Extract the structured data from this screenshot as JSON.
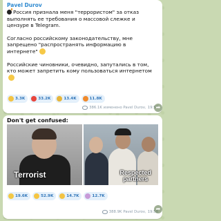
{
  "message1": {
    "sender": "Pavel Durov",
    "paragraphs": [
      "Россия признала меня \"террористом\" за отказ выполнять ее требования о массовой слежке и цензуре в Telegram.",
      "Согласно российскому законодательству, мне запрещено \"распространять информацию в интернете\"",
      "Российские чиновники, очевидно, запутались в том, кто может запретить кому пользоваться интернетом"
    ],
    "reactions": [
      {
        "emoji": "thumbs-up",
        "count": "3.3K"
      },
      {
        "emoji": "heart",
        "count": "33.2K"
      },
      {
        "emoji": "trophy",
        "count": "13.4K"
      },
      {
        "emoji": "fire",
        "count": "11.8K"
      }
    ],
    "views": "386.1K",
    "signature": "изменено Pavel Durov,",
    "time": "19:57"
  },
  "message2": {
    "headline": "Don't get confused:",
    "caption_left": "Terrorist",
    "caption_right_line1": "Respected",
    "caption_right_line2": "partners",
    "reactions": [
      {
        "emoji": "clown",
        "count": "19.6K"
      },
      {
        "emoji": "laugh",
        "count": "52.9K"
      },
      {
        "emoji": "thumbs-up",
        "count": "14.7K"
      },
      {
        "emoji": "unicorn",
        "count": "12.7K"
      }
    ],
    "views": "388.9K",
    "signature": "Pavel Durov,",
    "time": "19:58"
  }
}
